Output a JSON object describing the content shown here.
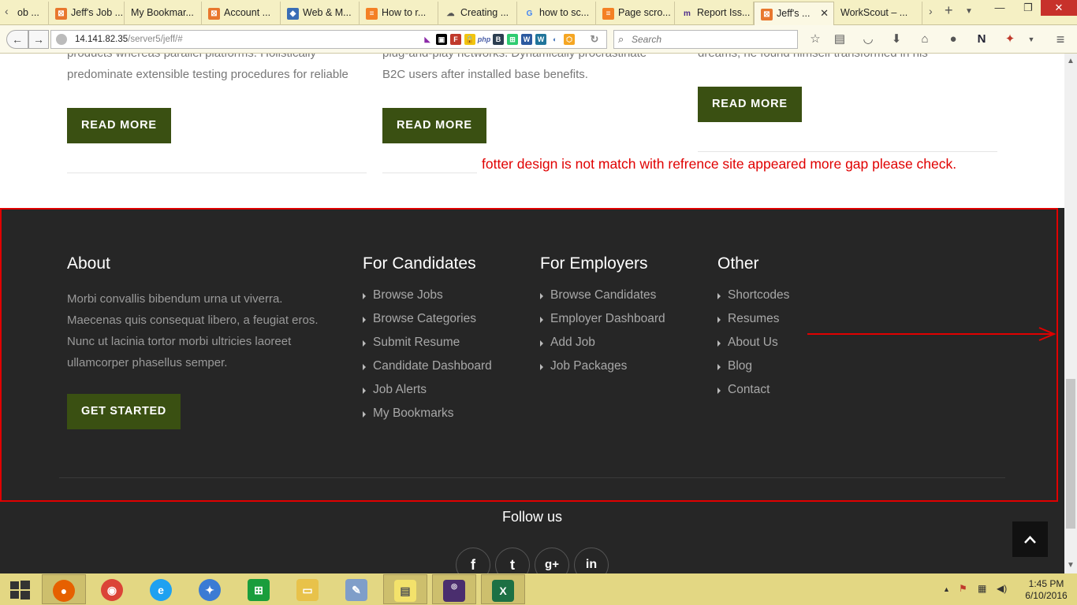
{
  "browser": {
    "tabs": [
      {
        "label": "ob ...",
        "icon": "html-icon"
      },
      {
        "label": "Jeff's Job ...",
        "icon": "html-icon"
      },
      {
        "label": "My Bookmar...",
        "icon": "none"
      },
      {
        "label": "Account ...",
        "icon": "html-icon"
      },
      {
        "label": "Web & M...",
        "icon": "shield-icon"
      },
      {
        "label": "How to r...",
        "icon": "stack-icon"
      },
      {
        "label": "Creating ...",
        "icon": "cloud-icon"
      },
      {
        "label": "how to sc...",
        "icon": "google-icon"
      },
      {
        "label": "Page scro...",
        "icon": "stack-icon"
      },
      {
        "label": "Report Iss...",
        "icon": "m-icon"
      },
      {
        "label": "Jeff's ...",
        "icon": "html-icon",
        "active": true
      },
      {
        "label": "WorkScout – ...",
        "icon": "none"
      }
    ],
    "url": "14.141.82.35",
    "url_path": "/server5/jeff/#",
    "search_placeholder": "Search"
  },
  "page": {
    "blog_columns": [
      {
        "text_line1": "products whereas parallel platforms. Holistically",
        "text_line2": "predominate extensible testing procedures for reliable",
        "button": "READ MORE"
      },
      {
        "text_line1": "plug-and-play networks. Dynamically procrastinate",
        "text_line2": "B2C users after installed base benefits.",
        "button": "READ MORE"
      },
      {
        "text_line1": "dreams, he found himself transformed in his",
        "button": "READ MORE"
      }
    ],
    "annotation": "fotter design is not match with refrence site appeared more gap please check.",
    "footer": {
      "about": {
        "title": "About",
        "text": "Morbi convallis bibendum urna ut viverra. Maecenas quis consequat libero, a feugiat eros. Nunc ut lacinia tortor morbi ultricies laoreet ullamcorper phasellus semper.",
        "button": "GET STARTED"
      },
      "candidates": {
        "title": "For Candidates",
        "links": [
          "Browse Jobs",
          "Browse Categories",
          "Submit Resume",
          "Candidate Dashboard",
          "Job Alerts",
          "My Bookmarks"
        ]
      },
      "employers": {
        "title": "For Employers",
        "links": [
          "Browse Candidates",
          "Employer Dashboard",
          "Add Job",
          "Job Packages"
        ]
      },
      "other": {
        "title": "Other",
        "links": [
          "Shortcodes",
          "Resumes",
          "About Us",
          "Blog",
          "Contact"
        ]
      },
      "follow_us": "Follow us",
      "social": [
        "f",
        "t",
        "g+",
        "in"
      ]
    }
  },
  "taskbar": {
    "clock_time": "1:45 PM",
    "clock_date": "6/10/2016"
  },
  "colors": {
    "accent_green": "#3a5012",
    "footer_bg": "#262626",
    "annotation_red": "#e00000",
    "tabbar_bg": "#f5f0c4"
  }
}
